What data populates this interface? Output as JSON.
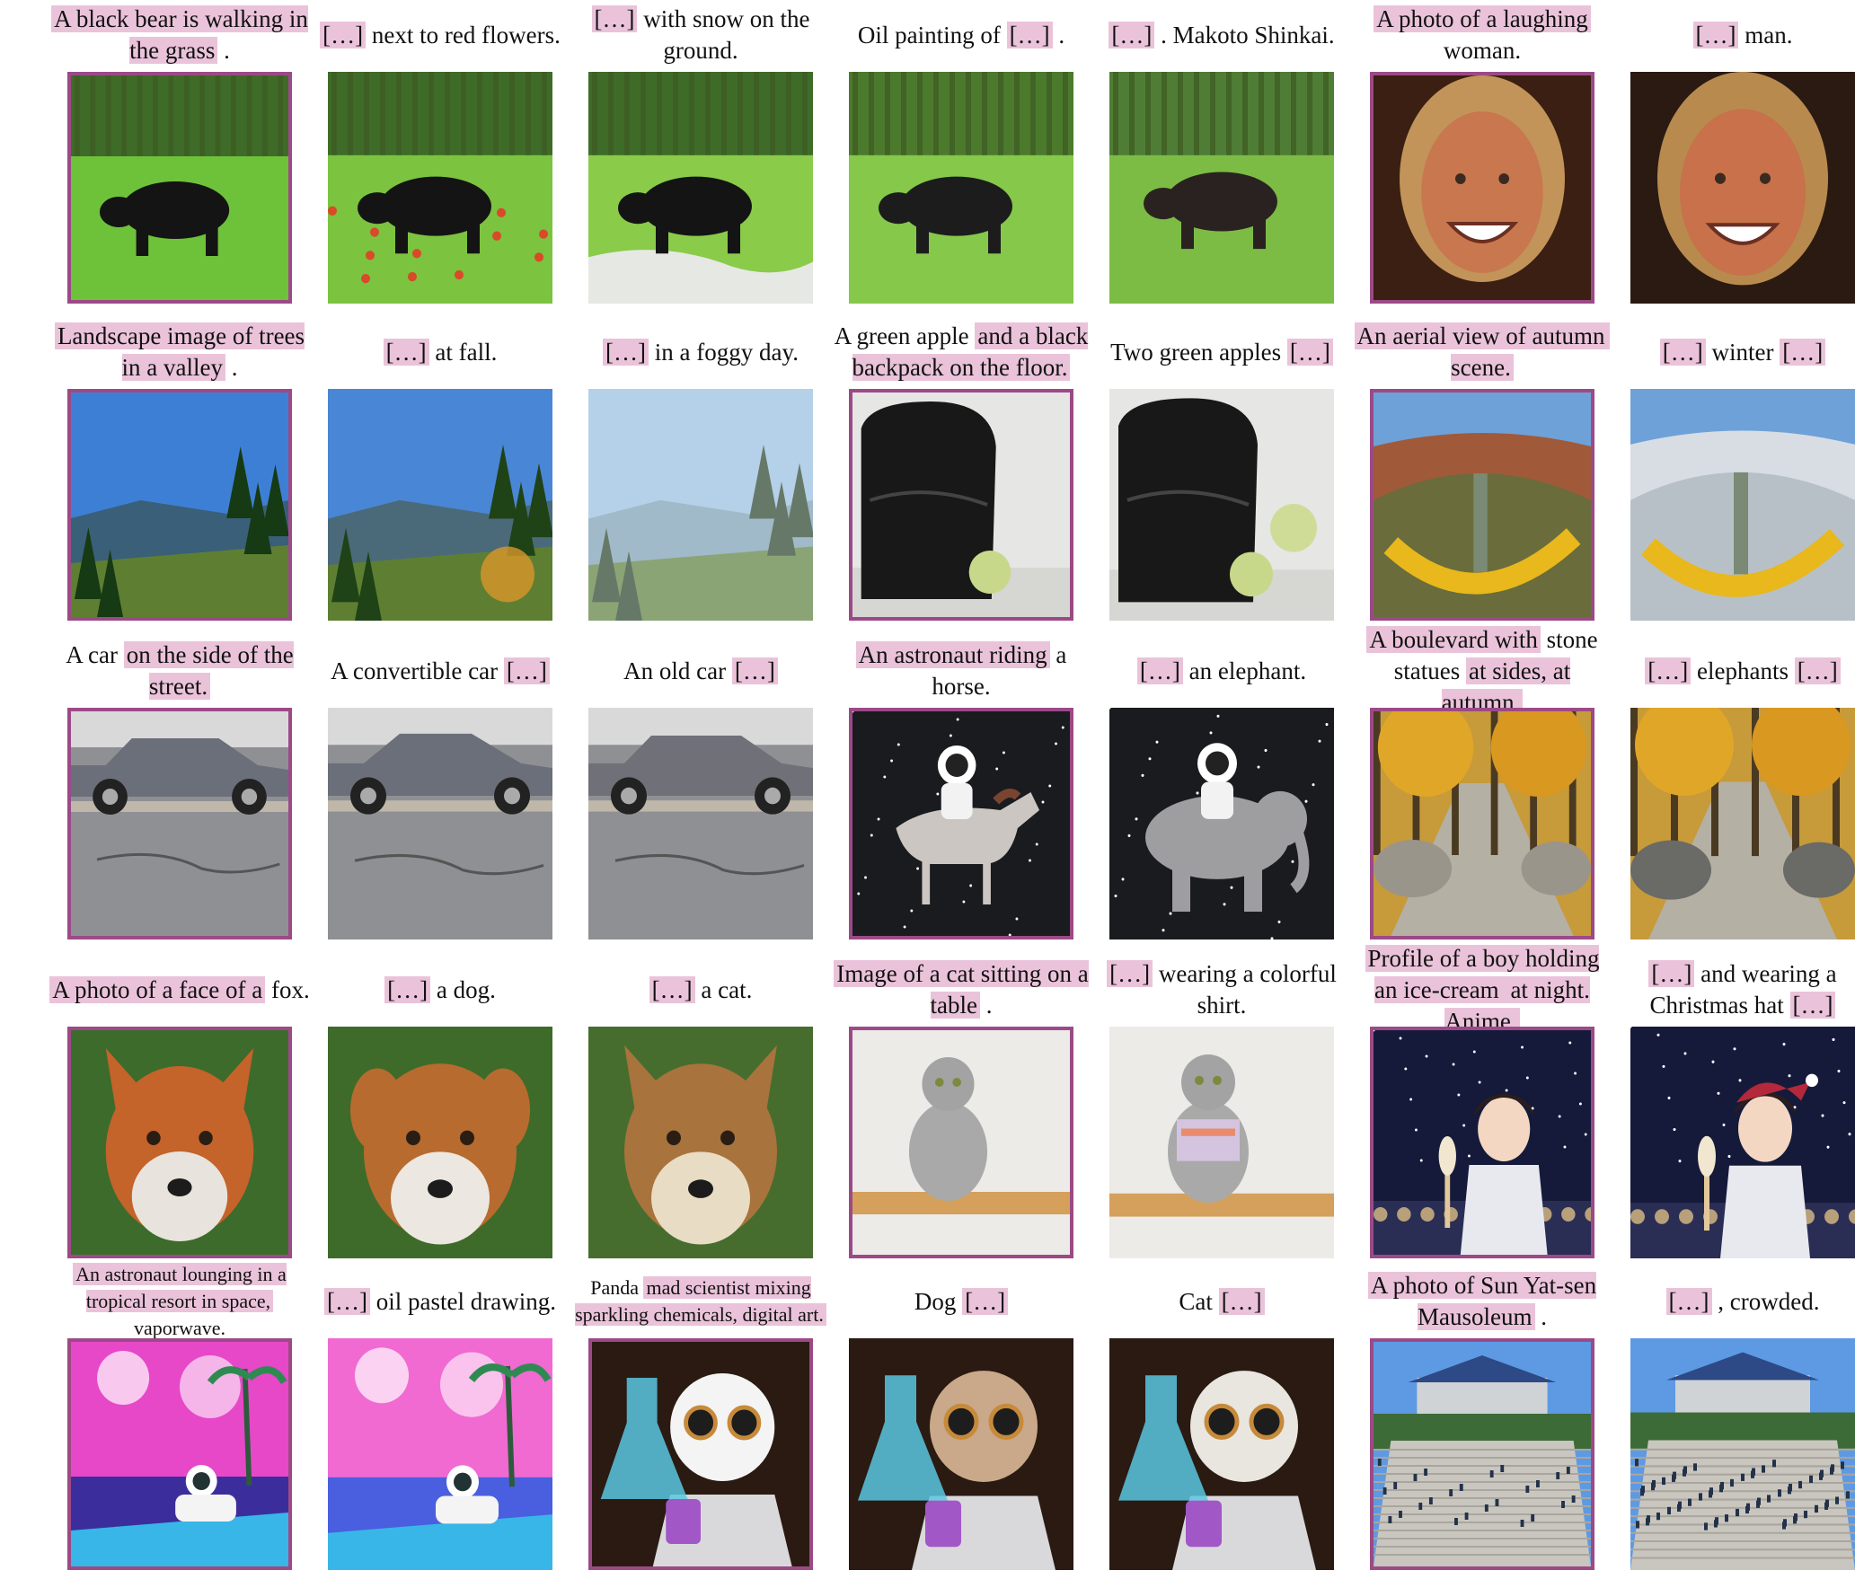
{
  "rows": [
    {
      "items": [
        {
          "ref": true,
          "scene": "bear",
          "caption": [
            {
              "t": "A black bear is walking in the grass",
              "h": true
            },
            {
              "t": " .",
              "h": false
            }
          ]
        },
        {
          "ref": false,
          "scene": "bear-flowers",
          "caption": [
            {
              "t": "[…]",
              "h": true
            },
            {
              "t": " next to red flowers.",
              "h": false
            }
          ]
        },
        {
          "ref": false,
          "scene": "bear-snow",
          "caption": [
            {
              "t": "[…]",
              "h": true
            },
            {
              "t": " with snow on the ground.",
              "h": false
            }
          ]
        },
        {
          "ref": false,
          "scene": "bear-oil",
          "caption": [
            {
              "t": "Oil painting of ",
              "h": false
            },
            {
              "t": "[…]",
              "h": true
            },
            {
              "t": " .",
              "h": false
            }
          ]
        },
        {
          "ref": false,
          "scene": "bear-shinkai",
          "caption": [
            {
              "t": "[…]",
              "h": true
            },
            {
              "t": " . Makoto Shinkai.",
              "h": false
            }
          ]
        },
        {
          "ref": true,
          "scene": "woman",
          "caption": [
            {
              "t": "A photo of a laughing",
              "h": true
            },
            {
              "t": " woman.",
              "h": false
            }
          ]
        },
        {
          "ref": false,
          "scene": "man",
          "caption": [
            {
              "t": "[…]",
              "h": true
            },
            {
              "t": " man.",
              "h": false
            }
          ]
        }
      ]
    },
    {
      "items": [
        {
          "ref": true,
          "scene": "valley",
          "caption": [
            {
              "t": "Landscape image of trees in a valley",
              "h": true
            },
            {
              "t": " .",
              "h": false
            }
          ]
        },
        {
          "ref": false,
          "scene": "valley-fall",
          "caption": [
            {
              "t": "[…]",
              "h": true
            },
            {
              "t": " at fall.",
              "h": false
            }
          ]
        },
        {
          "ref": false,
          "scene": "valley-fog",
          "caption": [
            {
              "t": "[…]",
              "h": true
            },
            {
              "t": " in a foggy day.",
              "h": false
            }
          ]
        },
        {
          "ref": true,
          "scene": "backpack",
          "caption": [
            {
              "t": "A green apple ",
              "h": false
            },
            {
              "t": "and a black backpack on the floor.",
              "h": true
            }
          ]
        },
        {
          "ref": false,
          "scene": "backpack-two",
          "caption": [
            {
              "t": "Two green apples ",
              "h": false
            },
            {
              "t": "[…]",
              "h": true
            }
          ]
        },
        {
          "ref": true,
          "scene": "aerial",
          "caption": [
            {
              "t": "An aerial view of autumn",
              "h": true
            },
            {
              "t": " scene.",
              "h": true
            }
          ]
        },
        {
          "ref": false,
          "scene": "aerial-winter",
          "caption": [
            {
              "t": "[…]",
              "h": true
            },
            {
              "t": " winter ",
              "h": false
            },
            {
              "t": "[…]",
              "h": true
            }
          ]
        }
      ]
    },
    {
      "items": [
        {
          "ref": true,
          "scene": "car",
          "caption": [
            {
              "t": "A car ",
              "h": false
            },
            {
              "t": "on the side of the street.",
              "h": true
            }
          ]
        },
        {
          "ref": false,
          "scene": "car-convertible",
          "caption": [
            {
              "t": "A convertible car ",
              "h": false
            },
            {
              "t": "[…]",
              "h": true
            }
          ]
        },
        {
          "ref": false,
          "scene": "car-old",
          "caption": [
            {
              "t": "An old car ",
              "h": false
            },
            {
              "t": "[…]",
              "h": true
            }
          ]
        },
        {
          "ref": true,
          "scene": "astro-horse",
          "caption": [
            {
              "t": "An astronaut riding",
              "h": true
            },
            {
              "t": " a horse.",
              "h": false
            }
          ]
        },
        {
          "ref": false,
          "scene": "astro-elephant",
          "caption": [
            {
              "t": "[…]",
              "h": true
            },
            {
              "t": " an elephant.",
              "h": false
            }
          ]
        },
        {
          "ref": true,
          "scene": "boulevard",
          "caption": [
            {
              "t": "A boulevard with",
              "h": true
            },
            {
              "t": " stone statues ",
              "h": false
            },
            {
              "t": "at sides, at autumn.",
              "h": true
            }
          ]
        },
        {
          "ref": false,
          "scene": "boulevard-elephants",
          "caption": [
            {
              "t": "[…]",
              "h": true
            },
            {
              "t": " elephants ",
              "h": false
            },
            {
              "t": "[…]",
              "h": true
            }
          ]
        }
      ]
    },
    {
      "items": [
        {
          "ref": true,
          "scene": "fox",
          "caption": [
            {
              "t": "A photo of a face of a",
              "h": true
            },
            {
              "t": " fox.",
              "h": false
            }
          ]
        },
        {
          "ref": false,
          "scene": "dog",
          "caption": [
            {
              "t": "[…]",
              "h": true
            },
            {
              "t": " a dog.",
              "h": false
            }
          ]
        },
        {
          "ref": false,
          "scene": "cat",
          "caption": [
            {
              "t": "[…]",
              "h": true
            },
            {
              "t": " a cat.",
              "h": false
            }
          ]
        },
        {
          "ref": true,
          "scene": "table-cat",
          "caption": [
            {
              "t": "Image of a cat sitting on a table",
              "h": true
            },
            {
              "t": " .",
              "h": false
            }
          ]
        },
        {
          "ref": false,
          "scene": "table-cat-shirt",
          "caption": [
            {
              "t": "[…]",
              "h": true
            },
            {
              "t": " wearing a colorful shirt.",
              "h": false
            }
          ]
        },
        {
          "ref": true,
          "scene": "anime-boy",
          "caption": [
            {
              "t": "Profile of a boy holding an ice-cream ",
              "h": true
            },
            {
              "t": " at night. Anime.",
              "h": true
            }
          ]
        },
        {
          "ref": false,
          "scene": "anime-boy-hat",
          "caption": [
            {
              "t": "[…]",
              "h": true
            },
            {
              "t": " and wearing a Christmas hat ",
              "h": false
            },
            {
              "t": "[…]",
              "h": true
            }
          ]
        }
      ]
    },
    {
      "items": [
        {
          "ref": true,
          "scene": "vaporwave",
          "small": true,
          "caption": [
            {
              "t": "An astronaut lounging in a tropical resort in space,",
              "h": true
            },
            {
              "t": " vaporwave.",
              "h": false
            }
          ]
        },
        {
          "ref": false,
          "scene": "vaporwave-pastel",
          "caption": [
            {
              "t": "[…]",
              "h": true
            },
            {
              "t": " oil pastel drawing.",
              "h": false
            }
          ]
        },
        {
          "ref": true,
          "scene": "panda",
          "small": true,
          "caption": [
            {
              "t": "Panda ",
              "h": false
            },
            {
              "t": "mad scientist mixing sparkling chemicals, digital art.",
              "h": true
            }
          ]
        },
        {
          "ref": false,
          "scene": "panda-dog",
          "caption": [
            {
              "t": "Dog ",
              "h": false
            },
            {
              "t": "[…]",
              "h": true
            }
          ]
        },
        {
          "ref": false,
          "scene": "panda-cat",
          "caption": [
            {
              "t": "Cat ",
              "h": false
            },
            {
              "t": "[…]",
              "h": true
            }
          ]
        },
        {
          "ref": true,
          "scene": "mausoleum",
          "caption": [
            {
              "t": "A photo of Sun Yat-sen Mausoleum",
              "h": true
            },
            {
              "t": " .",
              "h": false
            }
          ]
        },
        {
          "ref": false,
          "scene": "mausoleum-crowded",
          "caption": [
            {
              "t": "[…]",
              "h": true
            },
            {
              "t": " , crowded.",
              "h": false
            }
          ]
        }
      ]
    }
  ]
}
